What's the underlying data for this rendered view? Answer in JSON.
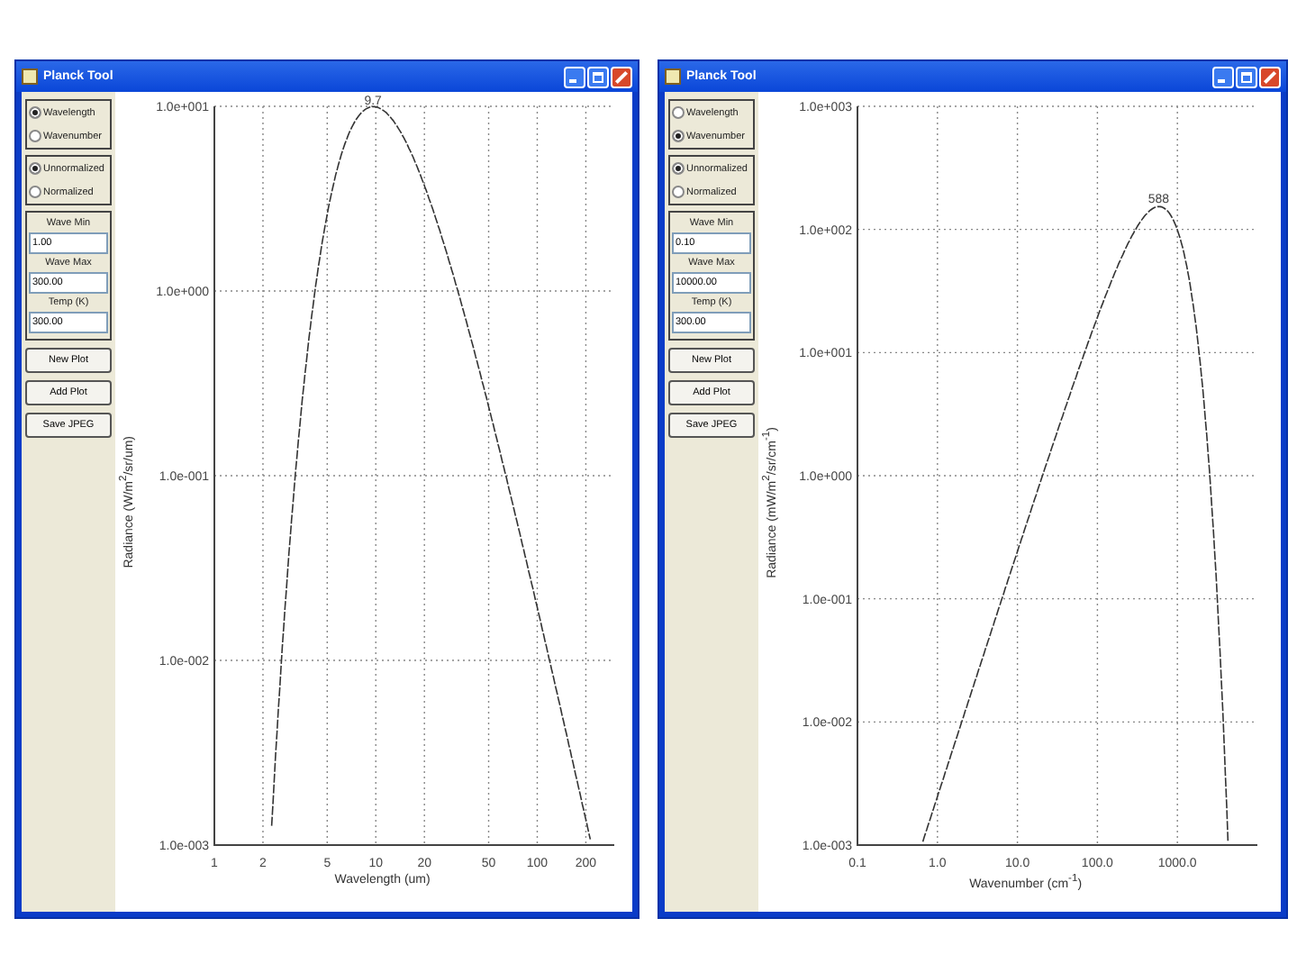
{
  "windows": [
    {
      "title": "Planck Tool",
      "mode_options": [
        {
          "label": "Wavelength",
          "selected": true
        },
        {
          "label": "Wavenumber",
          "selected": false
        }
      ],
      "norm_options": [
        {
          "label": "Unnormalized",
          "selected": true
        },
        {
          "label": "Normalized",
          "selected": false
        }
      ],
      "fields": [
        {
          "label": "Wave Min",
          "value": "1.00"
        },
        {
          "label": "Wave Max",
          "value": "300.00"
        },
        {
          "label": "Temp (K)",
          "value": "300.00"
        }
      ],
      "buttons": [
        {
          "label": "New Plot"
        },
        {
          "label": "Add Plot"
        },
        {
          "label": "Save JPEG"
        }
      ],
      "plot": {
        "ylabel": "Radiance (W/m$^{2}$/sr/um)",
        "xlabel": "Wavelength (um)",
        "y_tick_labels": [
          "1.0e+001",
          "1.0e+000",
          "1.0e-001",
          "1.0e-002",
          "1.0e-003"
        ],
        "x_tick_labels": [
          "1",
          "2",
          "5",
          "10",
          "20",
          "50",
          "100",
          "200"
        ],
        "peak_label": "9.7"
      }
    },
    {
      "title": "Planck Tool",
      "mode_options": [
        {
          "label": "Wavelength",
          "selected": false
        },
        {
          "label": "Wavenumber",
          "selected": true
        }
      ],
      "norm_options": [
        {
          "label": "Unnormalized",
          "selected": true
        },
        {
          "label": "Normalized",
          "selected": false
        }
      ],
      "fields": [
        {
          "label": "Wave Min",
          "value": "0.10"
        },
        {
          "label": "Wave Max",
          "value": "10000.00"
        },
        {
          "label": "Temp (K)",
          "value": "300.00"
        }
      ],
      "buttons": [
        {
          "label": "New Plot"
        },
        {
          "label": "Add Plot"
        },
        {
          "label": "Save JPEG"
        }
      ],
      "plot": {
        "ylabel": "Radiance (mW/m$^{2}$/sr/cm$^{-1}$)",
        "xlabel": "Wavenumber (cm$^{-1}$)",
        "y_tick_labels": [
          "1.0e+003",
          "1.0e+002",
          "1.0e+001",
          "1.0e+000",
          "1.0e-001",
          "1.0e-002",
          "1.0e-003"
        ],
        "x_tick_labels": [
          "0.1",
          "1.0",
          "10.0",
          "100.0",
          "1000.0"
        ],
        "peak_label": "588"
      }
    }
  ]
}
